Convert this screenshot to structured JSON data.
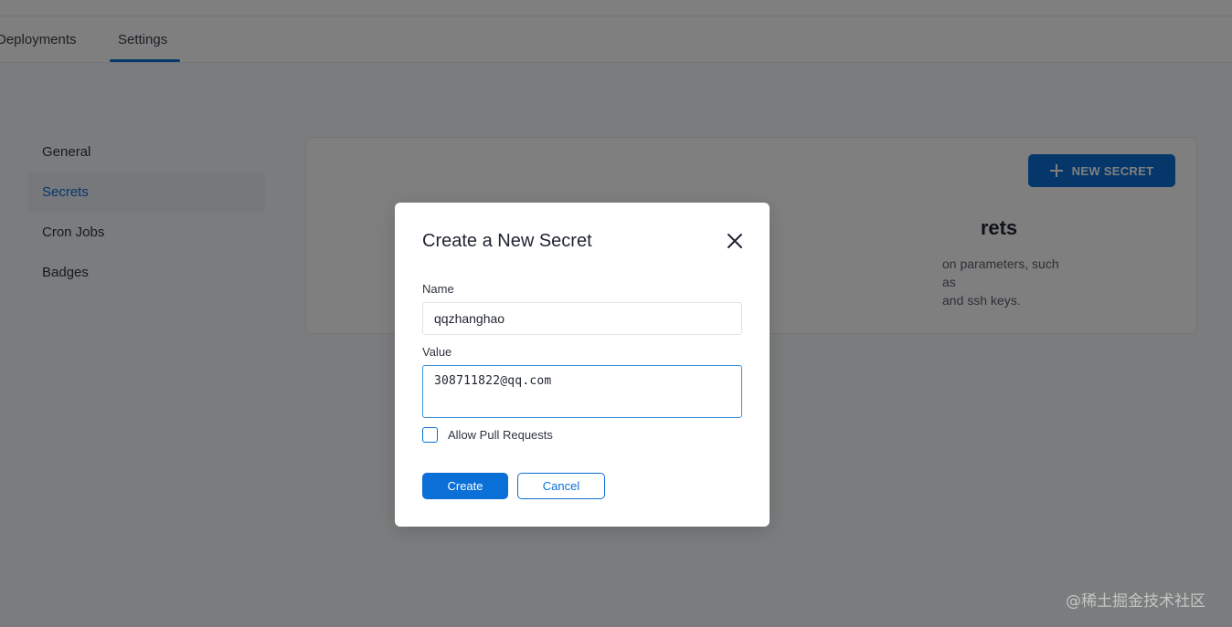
{
  "tabs": [
    {
      "label": "Deployments"
    },
    {
      "label": "Settings"
    }
  ],
  "sidebar": {
    "items": [
      {
        "label": "General"
      },
      {
        "label": "Secrets"
      },
      {
        "label": "Cron Jobs"
      },
      {
        "label": "Badges"
      }
    ]
  },
  "card": {
    "new_secret_label": "NEW SECRET",
    "title": "rets",
    "desc_line1": "on parameters, such as",
    "desc_line2": "and ssh keys."
  },
  "modal": {
    "title": "Create a New Secret",
    "name_label": "Name",
    "name_value": "qqzhanghao",
    "value_label": "Value",
    "value_value": "308711822@qq.com",
    "checkbox_label": "Allow Pull Requests",
    "create_label": "Create",
    "cancel_label": "Cancel"
  },
  "watermark": "@稀土掘金技术社区",
  "colors": {
    "accent": "#0a6fd6",
    "overlay": "rgba(0,0,0,0.5)"
  }
}
